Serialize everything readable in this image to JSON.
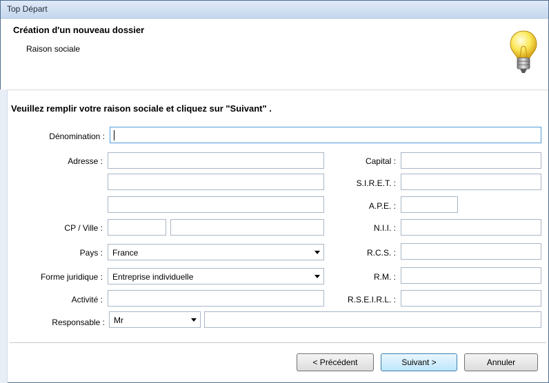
{
  "window": {
    "title": "Top Départ"
  },
  "header": {
    "title": "Création d'un nouveau dossier",
    "subtitle": "Raison sociale"
  },
  "instruction": "Veuillez remplir votre raison sociale et cliquez sur \"Suivant\" .",
  "labels": {
    "denomination": "Dénomination :",
    "adresse": "Adresse :",
    "cp_ville": "CP / Ville :",
    "pays": "Pays :",
    "forme": "Forme juridique :",
    "activite": "Activité :",
    "responsable": "Responsable :",
    "capital": "Capital :",
    "siret": "S.I.R.E.T. :",
    "ape": "A.P.E. :",
    "nii": "N.I.I. :",
    "rcs": "R.C.S. :",
    "rm": "R.M. :",
    "rseirl": "R.S.E.I.R.L. :"
  },
  "values": {
    "pays": "France",
    "forme": "Entreprise individuelle",
    "civilite": "Mr"
  },
  "buttons": {
    "previous": "< Précédent",
    "next": "Suivant >",
    "cancel": "Annuler"
  },
  "icons": {
    "header_icon": "lightbulb-icon",
    "dropdown": "chevron-down-icon"
  }
}
